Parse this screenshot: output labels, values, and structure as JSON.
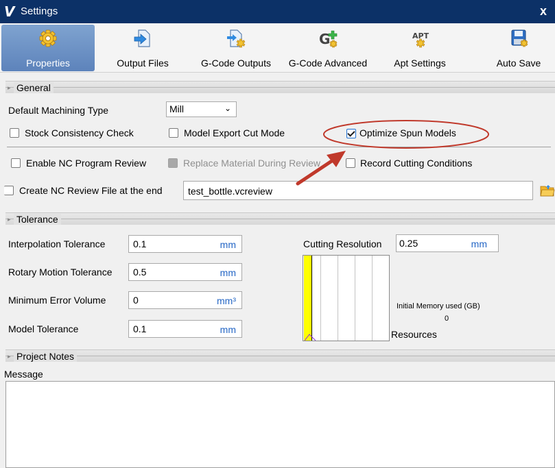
{
  "window": {
    "title": "Settings",
    "logo": "V",
    "close": "x"
  },
  "toolbar": {
    "items": [
      {
        "label": "Properties",
        "icon": "gear-icon",
        "active": true
      },
      {
        "label": "Output Files",
        "icon": "file-arrow-icon"
      },
      {
        "label": "G-Code Outputs",
        "icon": "file-gear-icon"
      },
      {
        "label": "G-Code Advanced",
        "icon": "g-code-plus-icon"
      },
      {
        "label": "Apt Settings",
        "icon": "apt-gear-icon"
      },
      {
        "label": "Auto Save",
        "icon": "save-disk-icon"
      }
    ]
  },
  "general": {
    "header": "General",
    "machining_type_label": "Default Machining Type",
    "machining_type_value": "Mill",
    "stock_consistency": {
      "label": "Stock Consistency Check",
      "checked": false
    },
    "model_export": {
      "label": "Model Export Cut Mode",
      "checked": false
    },
    "optimize_spun": {
      "label": "Optimize Spun Models",
      "checked": true
    },
    "enable_nc_review": {
      "label": "Enable NC Program Review",
      "checked": false
    },
    "replace_material": {
      "label": "Replace Material During Review",
      "checked": false,
      "disabled": true
    },
    "record_cutting": {
      "label": "Record Cutting Conditions",
      "checked": false
    },
    "create_review_file": {
      "label": "Create NC Review File at the end",
      "checked": false
    },
    "review_file_name": "test_bottle.vcreview"
  },
  "tolerance": {
    "header": "Tolerance",
    "interpolation": {
      "label": "Interpolation Tolerance",
      "value": "0.1",
      "unit": "mm"
    },
    "rotary": {
      "label": "Rotary Motion Tolerance",
      "value": "0.5",
      "unit": "mm"
    },
    "min_error": {
      "label": "Minimum Error Volume",
      "value": "0",
      "unit": "mm³"
    },
    "model": {
      "label": "Model Tolerance",
      "value": "0.1",
      "unit": "mm"
    },
    "cutting_resolution": {
      "label": "Cutting Resolution",
      "value": "0.25",
      "unit": "mm"
    },
    "memory_label": "Initial Memory used (GB)",
    "memory_value": "0",
    "resources_label": "Resources"
  },
  "project_notes": {
    "header": "Project Notes",
    "message_label": "Message",
    "message": ""
  },
  "colors": {
    "accent": "#0c3167",
    "annotation": "#c0392b",
    "unit": "#2466c5",
    "resource_bar": "#ffff00"
  }
}
